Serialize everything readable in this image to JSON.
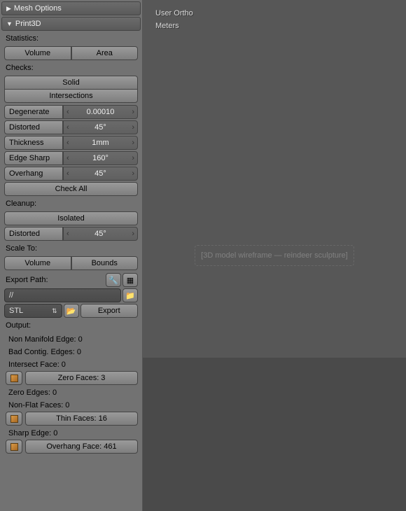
{
  "viewport": {
    "line1": "User Ortho",
    "line2": "Meters",
    "placeholder": "[3D model wireframe — reindeer sculpture]"
  },
  "headers": {
    "mesh_options": "Mesh Options",
    "print3d": "Print3D"
  },
  "labels": {
    "statistics": "Statistics:",
    "checks": "Checks:",
    "cleanup": "Cleanup:",
    "scale_to": "Scale To:",
    "export_path": "Export Path:",
    "output": "Output:"
  },
  "stats": {
    "volume": "Volume",
    "area": "Area"
  },
  "checks": {
    "solid": "Solid",
    "intersections": "Intersections",
    "degenerate": "Degenerate",
    "degenerate_val": "0.00010",
    "distorted": "Distorted",
    "distorted_val": "45°",
    "thickness": "Thickness",
    "thickness_val": "1mm",
    "edge_sharp": "Edge Sharp",
    "edge_sharp_val": "160°",
    "overhang": "Overhang",
    "overhang_val": "45°",
    "check_all": "Check All"
  },
  "cleanup": {
    "isolated": "Isolated",
    "distorted": "Distorted",
    "distorted_val": "45°"
  },
  "scale": {
    "volume": "Volume",
    "bounds": "Bounds"
  },
  "export": {
    "path": "//",
    "format": "STL",
    "export_btn": "Export"
  },
  "output": {
    "non_manifold": "Non Manifold Edge: 0",
    "bad_contig": "Bad Contig. Edges: 0",
    "intersect_face": "Intersect Face: 0",
    "zero_faces": "Zero Faces: 3",
    "zero_edges": "Zero Edges: 0",
    "non_flat": "Non-Flat Faces: 0",
    "thin_faces": "Thin Faces: 16",
    "sharp_edge": "Sharp Edge: 0",
    "overhang_face": "Overhang Face: 461"
  }
}
